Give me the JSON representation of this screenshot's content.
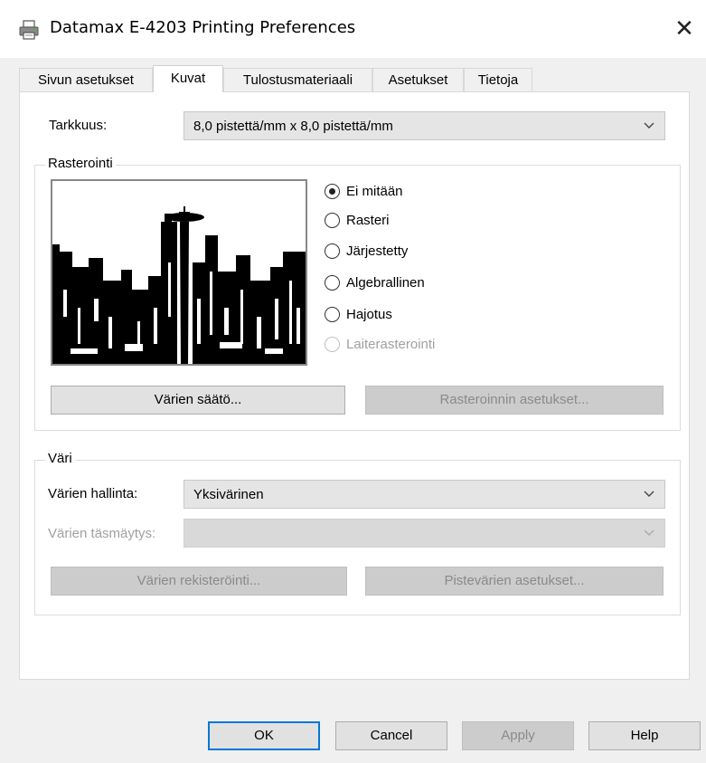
{
  "window": {
    "title": "Datamax E-4203 Printing Preferences",
    "close_glyph": "✕",
    "icon": "printer-icon"
  },
  "tabs": [
    {
      "label": "Sivun asetukset",
      "active": false
    },
    {
      "label": "Kuvat",
      "active": true
    },
    {
      "label": "Tulostusmateriaali",
      "active": false
    },
    {
      "label": "Asetukset",
      "active": false
    },
    {
      "label": "Tietoja",
      "active": false
    }
  ],
  "resolution": {
    "label": "Tarkkuus:",
    "value": "8,0 pistettä/mm x 8,0 pistettä/mm"
  },
  "dithering": {
    "title": "Rasterointi",
    "options": [
      {
        "label": "Ei mitään",
        "selected": true,
        "enabled": true
      },
      {
        "label": "Rasteri",
        "selected": false,
        "enabled": true
      },
      {
        "label": "Järjestetty",
        "selected": false,
        "enabled": true
      },
      {
        "label": "Algebrallinen",
        "selected": false,
        "enabled": true
      },
      {
        "label": "Hajotus",
        "selected": false,
        "enabled": true
      },
      {
        "label": "Laiterasterointi",
        "selected": false,
        "enabled": false
      }
    ],
    "color_adjust_button": "Värien säätö...",
    "dither_settings_button": "Rasteroinnin asetukset..."
  },
  "color": {
    "title": "Väri",
    "management_label": "Värien hallinta:",
    "management_value": "Yksivärinen",
    "matching_label": "Värien täsmäytys:",
    "matching_value": "",
    "register_button": "Värien rekisteröinti...",
    "spot_button": "Pistevärien asetukset..."
  },
  "footer": {
    "ok": "OK",
    "cancel": "Cancel",
    "apply": "Apply",
    "help": "Help"
  }
}
